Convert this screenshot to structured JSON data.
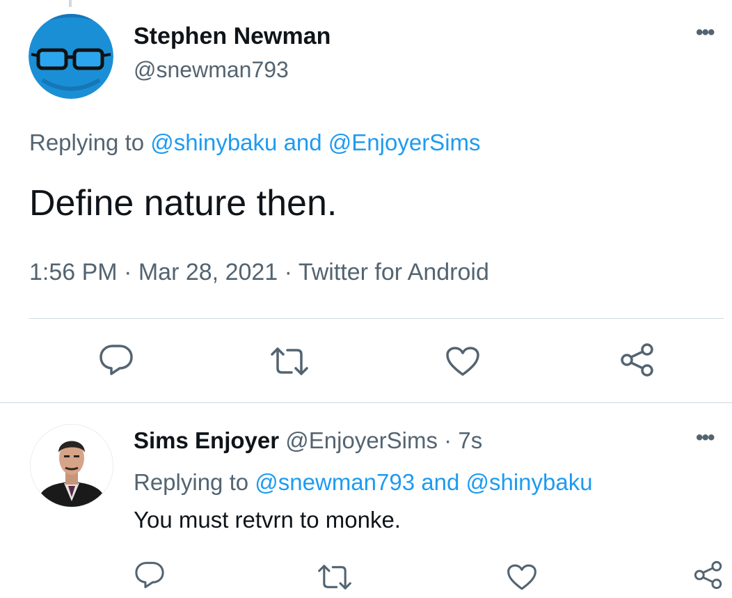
{
  "tweet": {
    "author_name": "Stephen Newman",
    "author_handle": "@snewman793",
    "replying_prefix": "Replying to",
    "replying_user1": "@shinybaku",
    "replying_and": "and",
    "replying_user2": "@EnjoyerSims",
    "text": "Define nature then.",
    "time": "1:56 PM",
    "date": "Mar 28, 2021",
    "source": "Twitter for Android",
    "separator": "·",
    "more": "•••"
  },
  "reply": {
    "author_name": "Sims Enjoyer",
    "author_handle": "@EnjoyerSims",
    "separator": "·",
    "age": "7s",
    "replying_prefix": "Replying to",
    "replying_user1": "@snewman793",
    "replying_and": "and",
    "replying_user2": "@shinybaku",
    "text": "You must retvrn to monke.",
    "more": "•••"
  },
  "icons": {
    "reply": "reply-icon",
    "retweet": "retweet-icon",
    "like": "heart-icon",
    "share": "share-icon",
    "more": "more-icon"
  },
  "colors": {
    "link": "#1d9bf0",
    "muted": "#536471",
    "text": "#0f1419",
    "divider": "#cfd9de"
  }
}
